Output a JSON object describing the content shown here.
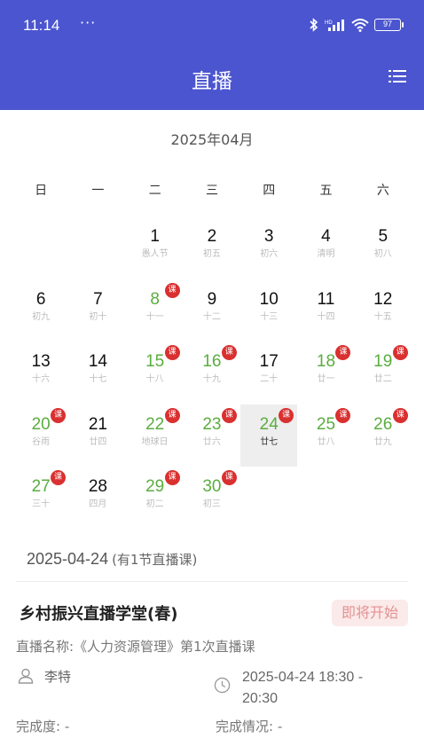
{
  "status_bar": {
    "time": "11:14",
    "dots": "···",
    "battery": "97",
    "signal_label": "HD"
  },
  "header": {
    "title": "直播"
  },
  "calendar": {
    "month_label": "2025年04月",
    "weekdays": [
      "日",
      "一",
      "二",
      "三",
      "四",
      "五",
      "六"
    ],
    "lead_blanks": 2,
    "badge_label": "课",
    "days": [
      {
        "day": "1",
        "lunar": "愚人节",
        "has_class": false,
        "selected": false
      },
      {
        "day": "2",
        "lunar": "初五",
        "has_class": false,
        "selected": false
      },
      {
        "day": "3",
        "lunar": "初六",
        "has_class": false,
        "selected": false
      },
      {
        "day": "4",
        "lunar": "清明",
        "has_class": false,
        "selected": false
      },
      {
        "day": "5",
        "lunar": "初八",
        "has_class": false,
        "selected": false
      },
      {
        "day": "6",
        "lunar": "初九",
        "has_class": false,
        "selected": false
      },
      {
        "day": "7",
        "lunar": "初十",
        "has_class": false,
        "selected": false
      },
      {
        "day": "8",
        "lunar": "十一",
        "has_class": true,
        "selected": false
      },
      {
        "day": "9",
        "lunar": "十二",
        "has_class": false,
        "selected": false
      },
      {
        "day": "10",
        "lunar": "十三",
        "has_class": false,
        "selected": false
      },
      {
        "day": "11",
        "lunar": "十四",
        "has_class": false,
        "selected": false
      },
      {
        "day": "12",
        "lunar": "十五",
        "has_class": false,
        "selected": false
      },
      {
        "day": "13",
        "lunar": "十六",
        "has_class": false,
        "selected": false
      },
      {
        "day": "14",
        "lunar": "十七",
        "has_class": false,
        "selected": false
      },
      {
        "day": "15",
        "lunar": "十八",
        "has_class": true,
        "selected": false
      },
      {
        "day": "16",
        "lunar": "十九",
        "has_class": true,
        "selected": false
      },
      {
        "day": "17",
        "lunar": "二十",
        "has_class": false,
        "selected": false
      },
      {
        "day": "18",
        "lunar": "廿一",
        "has_class": true,
        "selected": false
      },
      {
        "day": "19",
        "lunar": "廿二",
        "has_class": true,
        "selected": false
      },
      {
        "day": "20",
        "lunar": "谷雨",
        "has_class": true,
        "selected": false
      },
      {
        "day": "21",
        "lunar": "廿四",
        "has_class": false,
        "selected": false
      },
      {
        "day": "22",
        "lunar": "地球日",
        "has_class": true,
        "selected": false
      },
      {
        "day": "23",
        "lunar": "廿六",
        "has_class": true,
        "selected": false
      },
      {
        "day": "24",
        "lunar": "廿七",
        "has_class": true,
        "selected": true
      },
      {
        "day": "25",
        "lunar": "廿八",
        "has_class": true,
        "selected": false
      },
      {
        "day": "26",
        "lunar": "廿九",
        "has_class": true,
        "selected": false
      },
      {
        "day": "27",
        "lunar": "三十",
        "has_class": true,
        "selected": false
      },
      {
        "day": "28",
        "lunar": "四月",
        "has_class": false,
        "selected": false
      },
      {
        "day": "29",
        "lunar": "初二",
        "has_class": true,
        "selected": false
      },
      {
        "day": "30",
        "lunar": "初三",
        "has_class": true,
        "selected": false
      }
    ]
  },
  "selected_date": {
    "date": "2025-04-24",
    "count_text": "(有1节直播课)"
  },
  "course": {
    "title": "乡村振兴直播学堂(春)",
    "status": "即将开始",
    "live_name": "直播名称:《人力资源管理》第1次直播课",
    "teacher": "李特",
    "time_range": "2025-04-24 18:30 - 20:30",
    "progress": "完成度: -",
    "completion": "完成情况: -"
  },
  "colors": {
    "header_bg": "#4b55cf",
    "class_day": "#5aad3f",
    "badge": "#d93030",
    "status_bg": "#fbeaea",
    "status_text": "#e39191"
  }
}
